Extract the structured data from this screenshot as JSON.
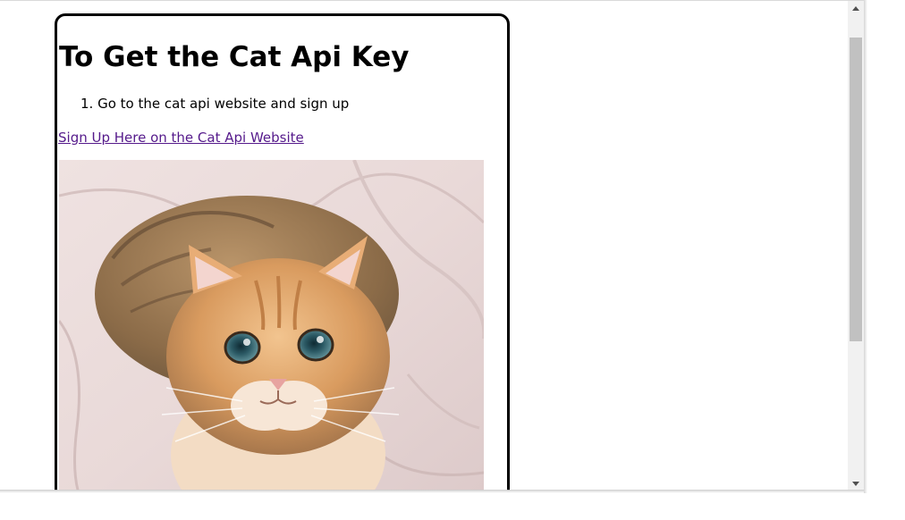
{
  "page": {
    "title": "To Get the Cat Api Key",
    "steps": [
      {
        "number": "1.",
        "text": "Go to the cat api website and sign up"
      }
    ],
    "signup_link": "Sign Up Here on the Cat Api Website",
    "image_alt": "cat photo"
  },
  "scrollbar": {
    "position_fraction": 0.0,
    "visible_fraction": 0.62
  },
  "colors": {
    "link_visited": "#551a8b",
    "card_border": "#000000",
    "scrollbar_track": "#f1f1f1",
    "scrollbar_thumb": "#c1c1c1"
  }
}
